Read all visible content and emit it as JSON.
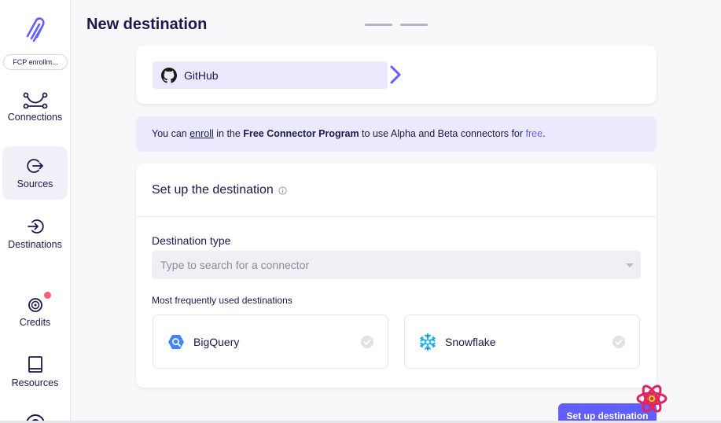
{
  "sidebar": {
    "workspace": "FCP enrollm...",
    "items": [
      {
        "label": "Connections",
        "icon": "connections-icon"
      },
      {
        "label": "Sources",
        "icon": "sources-icon"
      },
      {
        "label": "Destinations",
        "icon": "destinations-icon"
      },
      {
        "label": "Credits",
        "icon": "credits-icon"
      },
      {
        "label": "Resources",
        "icon": "resources-icon"
      }
    ]
  },
  "header": {
    "title": "New destination"
  },
  "source": {
    "name": "GitHub",
    "icon": "github-icon"
  },
  "banner": {
    "prefix": "You can ",
    "enroll": "enroll",
    "mid": " in the ",
    "program": "Free Connector Program",
    "mid2": " to use Alpha and Beta connectors for ",
    "free": "free",
    "end": "."
  },
  "setup": {
    "title": "Set up the destination",
    "destination_type_label": "Destination type",
    "search_placeholder": "Type to search for a connector",
    "frequent_label": "Most frequently used destinations",
    "options": [
      {
        "name": "BigQuery",
        "icon": "bigquery-icon"
      },
      {
        "name": "Snowflake",
        "icon": "snowflake-icon"
      }
    ]
  },
  "actions": {
    "submit": "Set up destination"
  },
  "colors": {
    "accent": "#615eff",
    "primary_text": "#1a194d",
    "banner_bg": "#ebe9fd",
    "badge": "#ff5e7b"
  }
}
